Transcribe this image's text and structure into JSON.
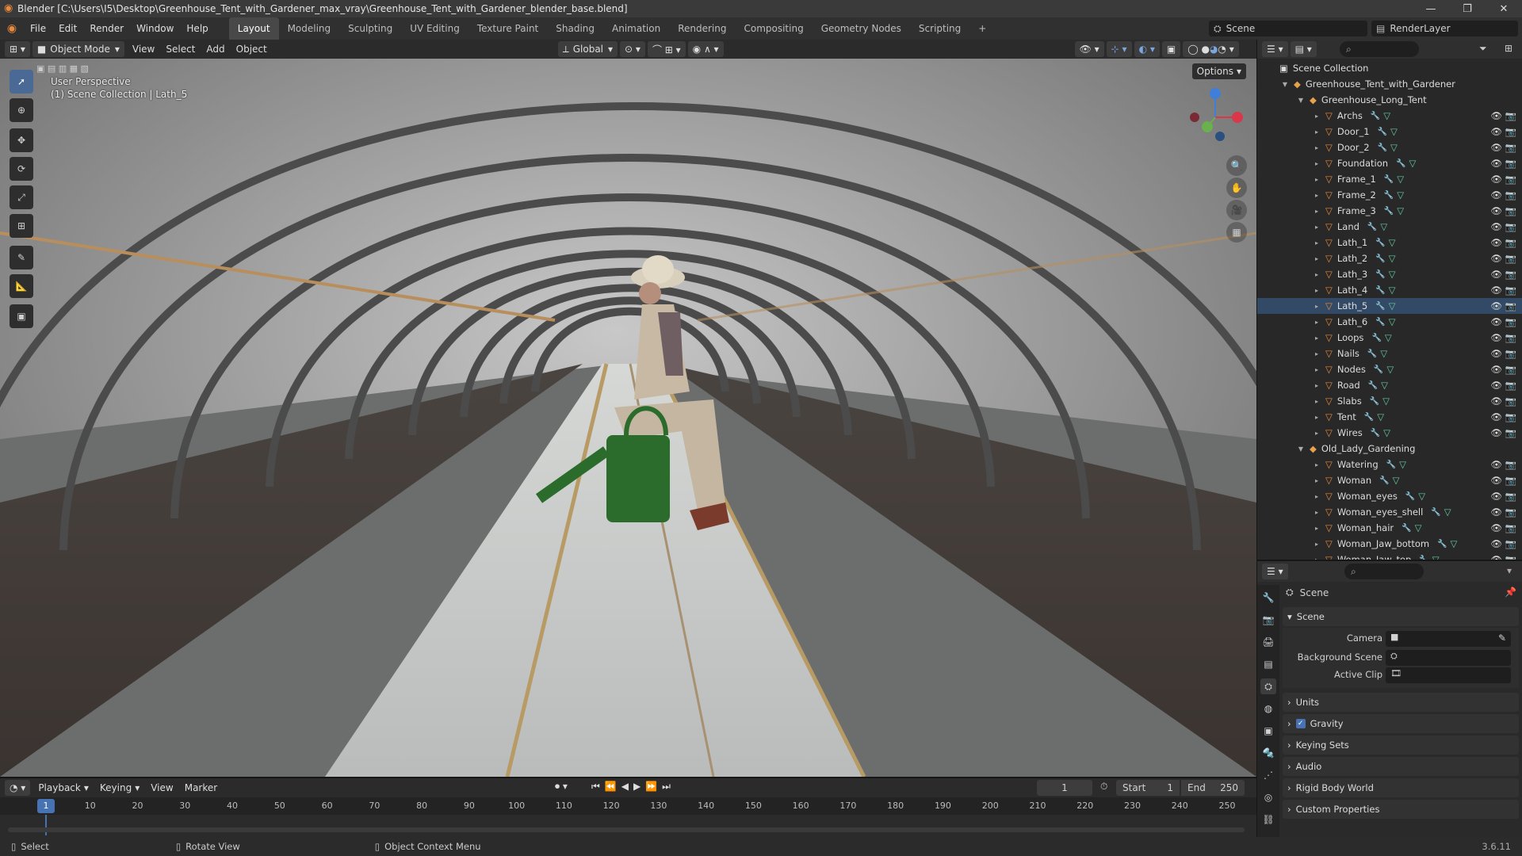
{
  "window": {
    "title": "Blender [C:\\Users\\I5\\Desktop\\Greenhouse_Tent_with_Gardener_max_vray\\Greenhouse_Tent_with_Gardener_blender_base.blend]"
  },
  "menu": {
    "items": [
      "File",
      "Edit",
      "Render",
      "Window",
      "Help"
    ]
  },
  "workspaces": {
    "tabs": [
      "Layout",
      "Modeling",
      "Sculpting",
      "UV Editing",
      "Texture Paint",
      "Shading",
      "Animation",
      "Rendering",
      "Compositing",
      "Geometry Nodes",
      "Scripting"
    ],
    "active": "Layout",
    "add": "+"
  },
  "scene_selector": {
    "scene": "Scene",
    "view_layer": "RenderLayer"
  },
  "header3d": {
    "mode": "Object Mode",
    "menus": [
      "View",
      "Select",
      "Add",
      "Object"
    ],
    "orientation": "Global",
    "options": "Options"
  },
  "viewport": {
    "perspective": "User Perspective",
    "collection": "(1) Scene Collection | Lath_5"
  },
  "outliner": {
    "root": "Scene Collection",
    "collection1": "Greenhouse_Tent_with_Gardener",
    "collection2": "Greenhouse_Long_Tent",
    "items1": [
      "Archs",
      "Door_1",
      "Door_2",
      "Foundation",
      "Frame_1",
      "Frame_2",
      "Frame_3",
      "Land",
      "Lath_1",
      "Lath_2",
      "Lath_3",
      "Lath_4",
      "Lath_5",
      "Lath_6",
      "Loops",
      "Nails",
      "Nodes",
      "Road",
      "Slabs",
      "Tent",
      "Wires"
    ],
    "collection3": "Old_Lady_Gardening",
    "items2": [
      "Watering",
      "Woman",
      "Woman_eyes",
      "Woman_eyes_shell",
      "Woman_hair",
      "Woman_Jaw_bottom",
      "Woman_Jaw_top"
    ],
    "selected": "Lath_5"
  },
  "properties": {
    "context": "Scene",
    "panel_scene": "Scene",
    "camera_label": "Camera",
    "bg_scene_label": "Background Scene",
    "active_clip_label": "Active Clip",
    "panels": [
      "Units",
      "Gravity",
      "Keying Sets",
      "Audio",
      "Rigid Body World",
      "Custom Properties"
    ],
    "gravity_checked": true
  },
  "timeline": {
    "menus": [
      "Playback",
      "Keying",
      "View",
      "Marker"
    ],
    "current_frame": "1",
    "start_label": "Start",
    "start": "1",
    "end_label": "End",
    "end": "250",
    "ticks": [
      "10",
      "20",
      "30",
      "40",
      "50",
      "60",
      "70",
      "80",
      "90",
      "100",
      "110",
      "120",
      "130",
      "140",
      "150",
      "160",
      "170",
      "180",
      "190",
      "200",
      "210",
      "220",
      "230",
      "240",
      "250"
    ],
    "playhead": "1"
  },
  "status": {
    "select": "Select",
    "rotate": "Rotate View",
    "context_menu": "Object Context Menu",
    "version": "3.6.11"
  },
  "colors": {
    "accent": "#4772b3",
    "selected_row": "#334a66",
    "object_icon": "#e88a3a",
    "mesh_icon": "#64c8a0",
    "collection_icon": "#e6a24a"
  }
}
